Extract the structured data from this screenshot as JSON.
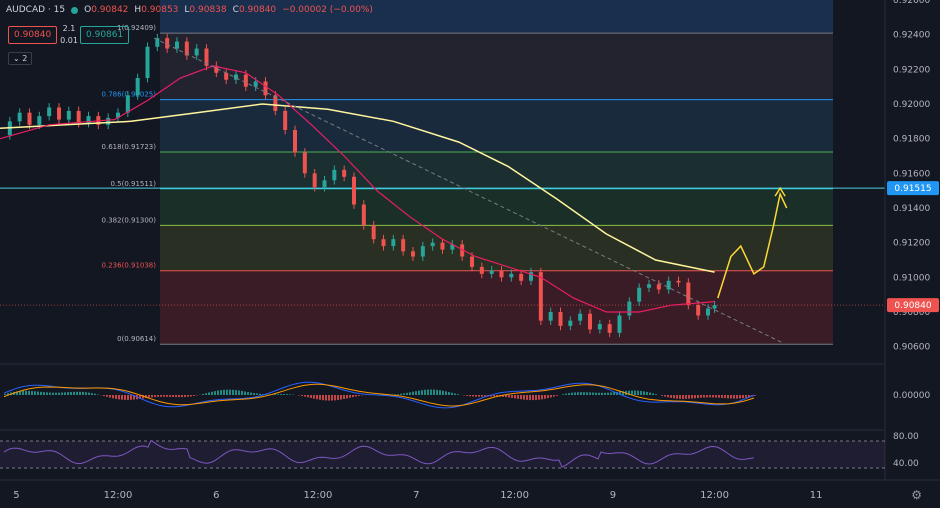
{
  "header": {
    "symbol": "AUDCAD · 15",
    "open_key": "O",
    "open": "0.90842",
    "high_key": "H",
    "high": "0.90853",
    "low_key": "L",
    "low": "0.90838",
    "close_key": "C",
    "close": "0.90840",
    "change": "−0.00002 (−0.00%)"
  },
  "trade": {
    "sell": "0.90840",
    "spread_top": "2.1",
    "spread_bottom": "0.01",
    "buy": "0.90861",
    "collapse": "2"
  },
  "colors": {
    "bg": "#131722",
    "up": "#26a69a",
    "down": "#ef5350",
    "ema_fast": "#e91e63",
    "ema_slow": "#fff59d",
    "macd": "#2962ff",
    "signal": "#ff9800",
    "rsi": "#7e57c2"
  },
  "chart_data": {
    "type": "candlestick",
    "y_axis": {
      "min": 0.905,
      "max": 0.926,
      "tick_labels": [
        "0.92600",
        "0.92400",
        "0.92200",
        "0.92000",
        "0.91800",
        "0.91600",
        "0.91400",
        "0.91200",
        "0.91000",
        "0.90800",
        "0.90600"
      ],
      "ticks": [
        0.926,
        0.924,
        0.922,
        0.92,
        0.918,
        0.916,
        0.914,
        0.912,
        0.91,
        0.908,
        0.906
      ]
    },
    "x_axis": {
      "labels": [
        "5",
        "12:00",
        "6",
        "12:00",
        "7",
        "12:00",
        "9",
        "12:00",
        "11"
      ],
      "positions": [
        0.5,
        3.6,
        6.6,
        9.7,
        12.7,
        15.7,
        18.7,
        21.8,
        24.9
      ],
      "max": 27
    },
    "current_price": "0.90840",
    "hline_price": "0.91515",
    "fibonacci": [
      {
        "ratio": "1",
        "price": 0.92409,
        "label": "1(0.92409)"
      },
      {
        "ratio": "0.786",
        "price": 0.92025,
        "label": "0.786(0.92025)"
      },
      {
        "ratio": "0.618",
        "price": 0.91723,
        "label": "0.618(0.91723)"
      },
      {
        "ratio": "0.5",
        "price": 0.91511,
        "label": "0.5(0.91511)"
      },
      {
        "ratio": "0.382",
        "price": 0.913,
        "label": "0.382(0.91300)"
      },
      {
        "ratio": "0.236",
        "price": 0.91038,
        "label": "0.236(0.91038)"
      },
      {
        "ratio": "0",
        "price": 0.90614,
        "label": "0(0.90614)"
      }
    ],
    "close_path": [
      [
        0,
        0.9182
      ],
      [
        0.3,
        0.919
      ],
      [
        0.6,
        0.9195
      ],
      [
        0.9,
        0.9188
      ],
      [
        1.2,
        0.9193
      ],
      [
        1.5,
        0.9198
      ],
      [
        1.8,
        0.9191
      ],
      [
        2.1,
        0.9196
      ],
      [
        2.4,
        0.9189
      ],
      [
        2.7,
        0.9193
      ],
      [
        3.0,
        0.9188
      ],
      [
        3.3,
        0.9192
      ],
      [
        3.6,
        0.9195
      ],
      [
        3.9,
        0.9205
      ],
      [
        4.2,
        0.9215
      ],
      [
        4.5,
        0.9233
      ],
      [
        4.8,
        0.9238
      ],
      [
        5.1,
        0.9232
      ],
      [
        5.4,
        0.9236
      ],
      [
        5.7,
        0.9228
      ],
      [
        6.0,
        0.9232
      ],
      [
        6.3,
        0.9222
      ],
      [
        6.6,
        0.9218
      ],
      [
        6.9,
        0.9214
      ],
      [
        7.2,
        0.9217
      ],
      [
        7.5,
        0.921
      ],
      [
        7.8,
        0.9213
      ],
      [
        8.1,
        0.9205
      ],
      [
        8.4,
        0.9196
      ],
      [
        8.7,
        0.9185
      ],
      [
        9.0,
        0.9172
      ],
      [
        9.3,
        0.916
      ],
      [
        9.6,
        0.9152
      ],
      [
        9.9,
        0.9156
      ],
      [
        10.2,
        0.9162
      ],
      [
        10.5,
        0.9158
      ],
      [
        10.8,
        0.9142
      ],
      [
        11.1,
        0.913
      ],
      [
        11.4,
        0.9122
      ],
      [
        11.7,
        0.9118
      ],
      [
        12.0,
        0.9122
      ],
      [
        12.3,
        0.9115
      ],
      [
        12.6,
        0.9112
      ],
      [
        12.9,
        0.9118
      ],
      [
        13.2,
        0.912
      ],
      [
        13.5,
        0.9116
      ],
      [
        13.8,
        0.9119
      ],
      [
        14.1,
        0.9112
      ],
      [
        14.4,
        0.9106
      ],
      [
        14.7,
        0.9102
      ],
      [
        15.0,
        0.9104
      ],
      [
        15.3,
        0.91
      ],
      [
        15.6,
        0.9102
      ],
      [
        15.9,
        0.9098
      ],
      [
        16.2,
        0.9103
      ],
      [
        16.5,
        0.9075
      ],
      [
        16.8,
        0.908
      ],
      [
        17.1,
        0.9072
      ],
      [
        17.4,
        0.9075
      ],
      [
        17.7,
        0.9079
      ],
      [
        18.0,
        0.907
      ],
      [
        18.3,
        0.9073
      ],
      [
        18.6,
        0.9068
      ],
      [
        18.9,
        0.9078
      ],
      [
        19.2,
        0.9086
      ],
      [
        19.5,
        0.9094
      ],
      [
        19.8,
        0.9096
      ],
      [
        20.1,
        0.9093
      ],
      [
        20.4,
        0.9098
      ],
      [
        20.7,
        0.9097
      ],
      [
        21.0,
        0.9084
      ],
      [
        21.3,
        0.9078
      ],
      [
        21.6,
        0.9082
      ],
      [
        21.8,
        0.9084
      ]
    ],
    "ema_fast": [
      [
        0,
        0.918
      ],
      [
        1.5,
        0.9188
      ],
      [
        3.5,
        0.9191
      ],
      [
        4.5,
        0.9202
      ],
      [
        5.5,
        0.9215
      ],
      [
        6.5,
        0.9222
      ],
      [
        7.5,
        0.9218
      ],
      [
        8.5,
        0.9205
      ],
      [
        9.5,
        0.9188
      ],
      [
        10.5,
        0.917
      ],
      [
        11.5,
        0.915
      ],
      [
        12.5,
        0.9135
      ],
      [
        13.5,
        0.9122
      ],
      [
        14.5,
        0.9112
      ],
      [
        15.5,
        0.9106
      ],
      [
        16.5,
        0.91
      ],
      [
        17.5,
        0.9088
      ],
      [
        18.5,
        0.908
      ],
      [
        19.5,
        0.908
      ],
      [
        20.5,
        0.9084
      ],
      [
        21.8,
        0.9086
      ]
    ],
    "ema_slow": [
      [
        0,
        0.9186
      ],
      [
        2,
        0.9188
      ],
      [
        4,
        0.919
      ],
      [
        6,
        0.9195
      ],
      [
        8,
        0.92
      ],
      [
        10,
        0.9197
      ],
      [
        12,
        0.919
      ],
      [
        14,
        0.9178
      ],
      [
        15.5,
        0.9164
      ],
      [
        17,
        0.9145
      ],
      [
        18.5,
        0.9125
      ],
      [
        20,
        0.911
      ],
      [
        21.8,
        0.9103
      ]
    ],
    "trendline": [
      [
        4.7,
        0.9238
      ],
      [
        23.9,
        0.9062
      ]
    ],
    "projection": [
      [
        21.9,
        0.9088
      ],
      [
        22.3,
        0.9112
      ],
      [
        22.6,
        0.9118
      ],
      [
        23.0,
        0.9102
      ],
      [
        23.3,
        0.9106
      ],
      [
        23.6,
        0.913
      ],
      [
        23.8,
        0.9148
      ],
      [
        24.0,
        0.914
      ]
    ],
    "macd": {
      "zero_label": "0.00000"
    },
    "rsi": {
      "labels": [
        "80.00",
        "40.00"
      ]
    }
  }
}
